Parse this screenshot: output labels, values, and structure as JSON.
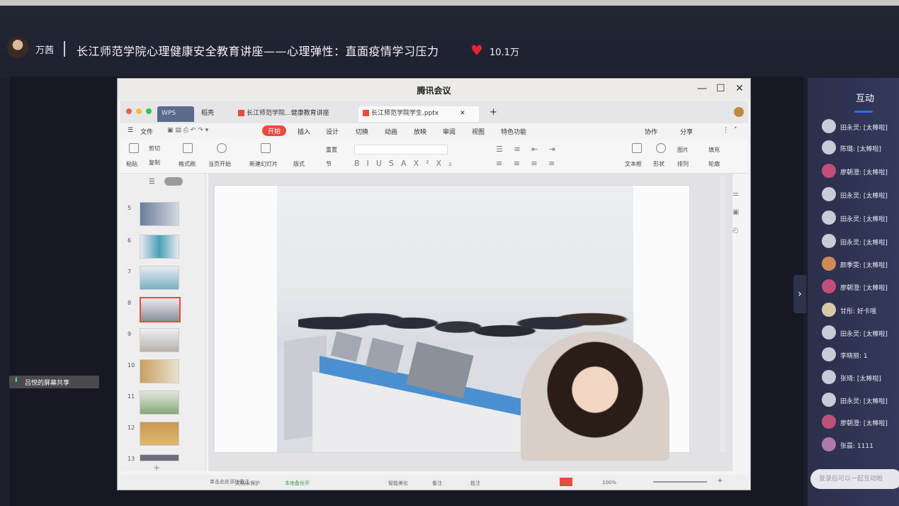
{
  "stream": {
    "host": "万茜",
    "title": "长江师范学院心理健康安全教育讲座——心理弹性：直面疫情学习压力",
    "likes": "10.1万"
  },
  "meeting": {
    "window_title": "腾讯会议",
    "min": "—",
    "max": "☐",
    "close": "✕"
  },
  "wps": {
    "tabs": [
      "WPS",
      "稻壳",
      "长江师范学院...健康教育讲座",
      "长江师范学院学生.pptx"
    ],
    "new_tab": "+",
    "menu": [
      "文件",
      "开始",
      "插入",
      "设计",
      "切换",
      "动画",
      "放映",
      "审阅",
      "视图",
      "特色功能"
    ],
    "menu_right": [
      "协作",
      "分享"
    ],
    "ribbon": [
      "粘贴",
      "剪切",
      "复制",
      "格式刷",
      "当页开始",
      "新建幻灯片",
      "版式",
      "重置",
      "节",
      "文本框",
      "形状",
      "排列",
      "图片",
      "填充",
      "轮廓"
    ],
    "ribbon_format": [
      "B",
      "I",
      "U",
      "S",
      "A",
      "X²",
      "X₂"
    ],
    "slide_numbers": [
      "5",
      "6",
      "7",
      "8",
      "9",
      "10",
      "11",
      "12",
      "13"
    ],
    "status_left": "单击此处添加备注",
    "status_items": [
      "文档未保护",
      "本地备份开",
      "智能美化",
      "备注",
      "批注",
      "100%"
    ]
  },
  "share_bar": {
    "label": "吕悦的屏幕共享"
  },
  "chat": {
    "tab": "互动",
    "messages": [
      {
        "name": "田永灵",
        "text": "[太棒啦]"
      },
      {
        "name": "陈璐",
        "text": "[太棒啦]"
      },
      {
        "name": "廖朝澄",
        "text": "[太棒啦]"
      },
      {
        "name": "田永灵",
        "text": "[太棒啦]"
      },
      {
        "name": "田永灵",
        "text": "[太棒啦]"
      },
      {
        "name": "田永灵",
        "text": "[太棒啦]"
      },
      {
        "name": "颜季雯",
        "text": "[太棒啦]"
      },
      {
        "name": "廖朝澄",
        "text": "[太棒啦]"
      },
      {
        "name": "甘彤",
        "text": "好卡哦"
      },
      {
        "name": "田永灵",
        "text": "[太棒啦]"
      },
      {
        "name": "李晓丽",
        "text": "1"
      },
      {
        "name": "张琦",
        "text": "[太棒啦]"
      },
      {
        "name": "田永灵",
        "text": "[太棒啦]"
      },
      {
        "name": "廖朝澄",
        "text": "[太棒啦]"
      },
      {
        "name": "张晨",
        "text": "1111"
      }
    ],
    "input_placeholder": "登录后可以一起互动啦",
    "toggle": "›"
  },
  "colors": {
    "accent": "#2f6cf6",
    "wps_red": "#e84c3d",
    "heart": "#e8232f"
  }
}
